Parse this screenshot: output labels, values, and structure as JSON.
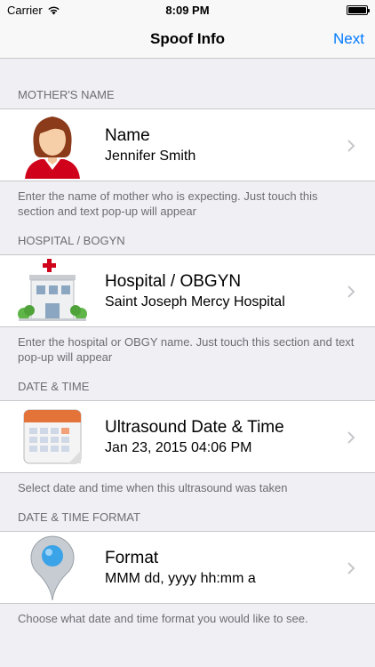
{
  "status": {
    "carrier": "Carrier",
    "time": "8:09 PM"
  },
  "nav": {
    "title": "Spoof Info",
    "next_label": "Next"
  },
  "sections": [
    {
      "header": "MOTHER'S NAME",
      "title": "Name",
      "value": "Jennifer Smith",
      "footer": "Enter the name of mother who is expecting. Just touch this section and text pop-up will appear",
      "icon": "mother-avatar-icon"
    },
    {
      "header": "HOSPITAL / BOGYN",
      "title": "Hospital / OBGYN",
      "value": "Saint Joseph Mercy Hospital",
      "footer": "Enter the hospital or OBGY name. Just touch this section and text pop-up will appear",
      "icon": "hospital-icon"
    },
    {
      "header": "DATE & TIME",
      "title": "Ultrasound Date & Time",
      "value": "Jan 23, 2015 04:06 PM",
      "footer": "Select date and time when this ultrasound was taken",
      "icon": "calendar-icon"
    },
    {
      "header": "DATE & TIME FORMAT",
      "title": "Format",
      "value": "MMM dd, yyyy hh:mm a",
      "footer": "Choose what date and time format you would like to see.",
      "icon": "map-pin-icon"
    }
  ],
  "colors": {
    "accent": "#007aff",
    "background": "#efeff4",
    "cross": "#d0021b"
  }
}
